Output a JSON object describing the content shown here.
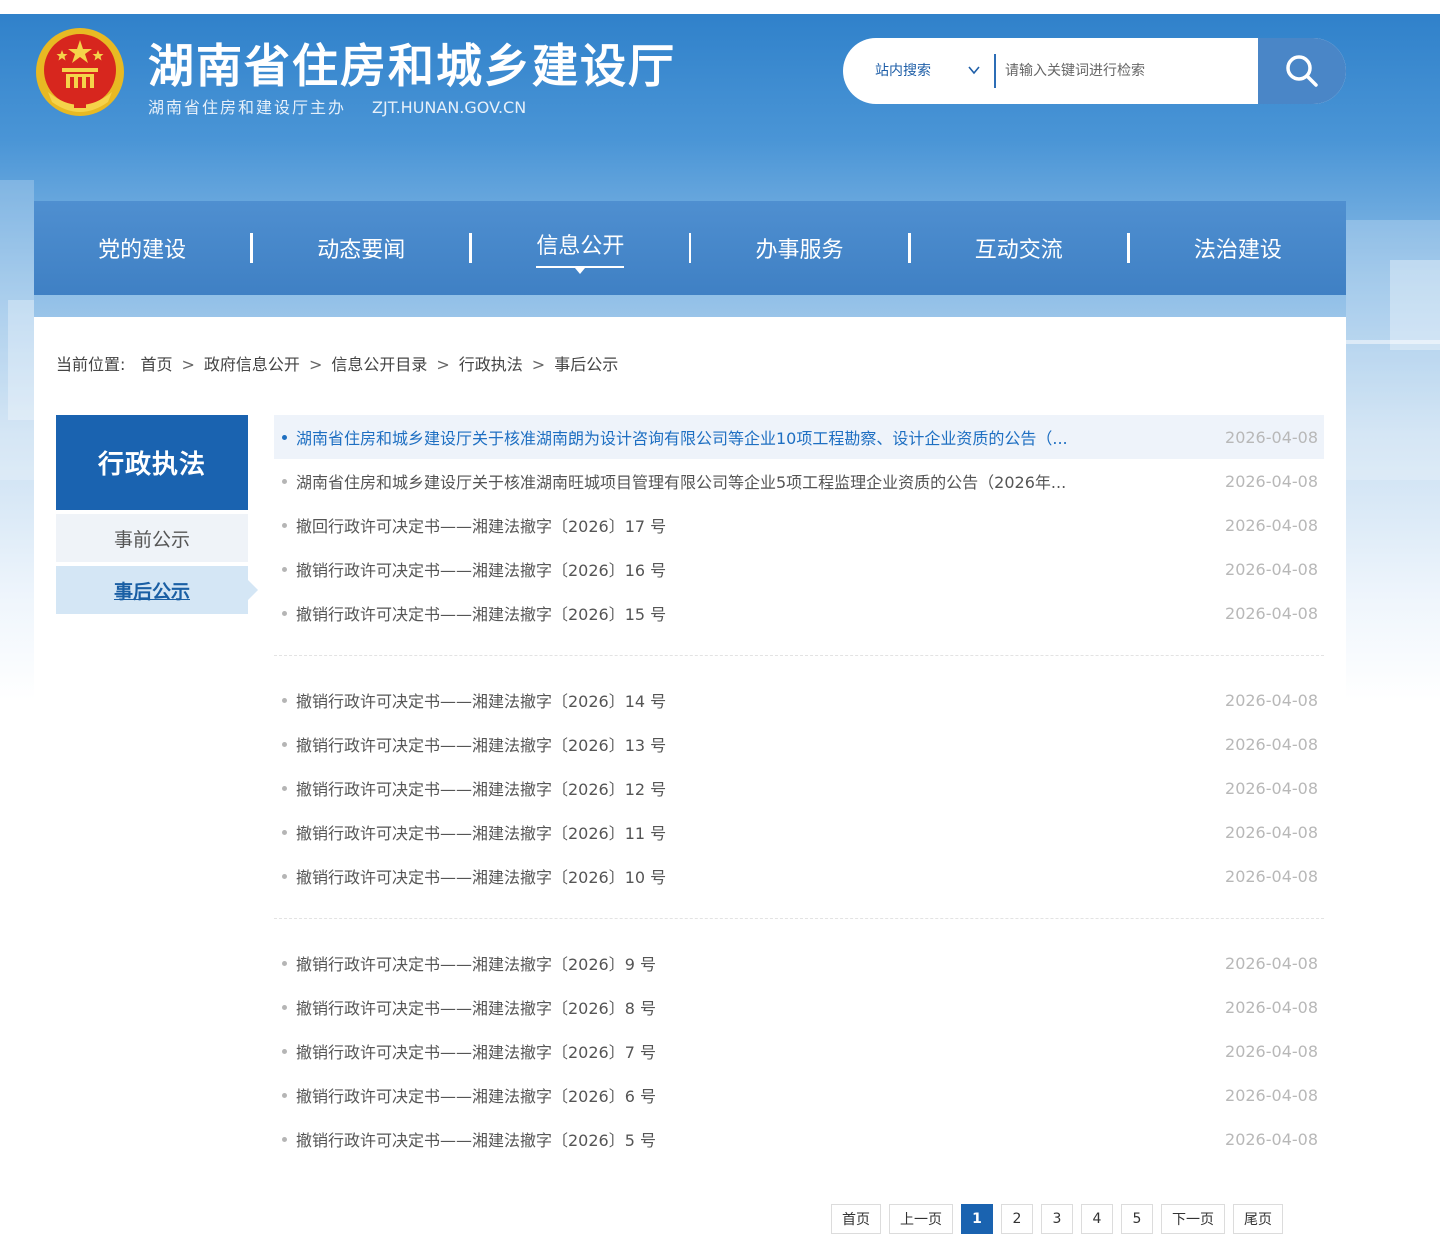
{
  "header": {
    "title": "湖南省住房和城乡建设厅",
    "subtitle": "湖南省住房和建设厅主办",
    "domain": "ZJT.HUNAN.GOV.CN"
  },
  "search": {
    "scope": "站内搜索",
    "placeholder": "请输入关键词进行检索"
  },
  "nav": {
    "items": [
      {
        "label": "党的建设"
      },
      {
        "label": "动态要闻"
      },
      {
        "label": "信息公开"
      },
      {
        "label": "办事服务"
      },
      {
        "label": "互动交流"
      },
      {
        "label": "法治建设"
      }
    ]
  },
  "breadcrumb": {
    "prefix": "当前位置:",
    "items": [
      "首页",
      "政府信息公开",
      "信息公开目录",
      "行政执法",
      "事后公示"
    ],
    "separator": ">"
  },
  "sidebar": {
    "title": "行政执法",
    "items": [
      {
        "label": "事前公示"
      },
      {
        "label": "事后公示"
      }
    ]
  },
  "list": {
    "items": [
      {
        "title": "湖南省住房和城乡建设厅关于核准湖南朗为设计咨询有限公司等企业10项工程勘察、设计企业资质的公告（...",
        "date": "2026-04-08"
      },
      {
        "title": "湖南省住房和城乡建设厅关于核准湖南旺城项目管理有限公司等企业5项工程监理企业资质的公告（2026年...",
        "date": "2026-04-08"
      },
      {
        "title": "撤回行政许可决定书——湘建法撤字〔2026〕17 号",
        "date": "2026-04-08"
      },
      {
        "title": "撤销行政许可决定书——湘建法撤字〔2026〕16 号",
        "date": "2026-04-08"
      },
      {
        "title": "撤销行政许可决定书——湘建法撤字〔2026〕15 号",
        "date": "2026-04-08"
      },
      {
        "title": "撤销行政许可决定书——湘建法撤字〔2026〕14 号",
        "date": "2026-04-08"
      },
      {
        "title": "撤销行政许可决定书——湘建法撤字〔2026〕13 号",
        "date": "2026-04-08"
      },
      {
        "title": "撤销行政许可决定书——湘建法撤字〔2026〕12 号",
        "date": "2026-04-08"
      },
      {
        "title": "撤销行政许可决定书——湘建法撤字〔2026〕11 号",
        "date": "2026-04-08"
      },
      {
        "title": "撤销行政许可决定书——湘建法撤字〔2026〕10 号",
        "date": "2026-04-08"
      },
      {
        "title": "撤销行政许可决定书——湘建法撤字〔2026〕9 号",
        "date": "2026-04-08"
      },
      {
        "title": "撤销行政许可决定书——湘建法撤字〔2026〕8 号",
        "date": "2026-04-08"
      },
      {
        "title": "撤销行政许可决定书——湘建法撤字〔2026〕7 号",
        "date": "2026-04-08"
      },
      {
        "title": "撤销行政许可决定书——湘建法撤字〔2026〕6 号",
        "date": "2026-04-08"
      },
      {
        "title": "撤销行政许可决定书——湘建法撤字〔2026〕5 号",
        "date": "2026-04-08"
      }
    ]
  },
  "pagination": {
    "first": "首页",
    "prev": "上一页",
    "pages": [
      "1",
      "2",
      "3",
      "4",
      "5"
    ],
    "current": "1",
    "next": "下一页",
    "last": "尾页"
  },
  "colors": {
    "primary": "#1a63b0",
    "nav_bg": "#4a8acb",
    "link_highlight": "#1e6fc2",
    "date": "#b8b8b8"
  },
  "icons": {
    "emblem": "national-emblem-icon",
    "search": "search-icon",
    "dropdown": "chevron-down-icon"
  }
}
